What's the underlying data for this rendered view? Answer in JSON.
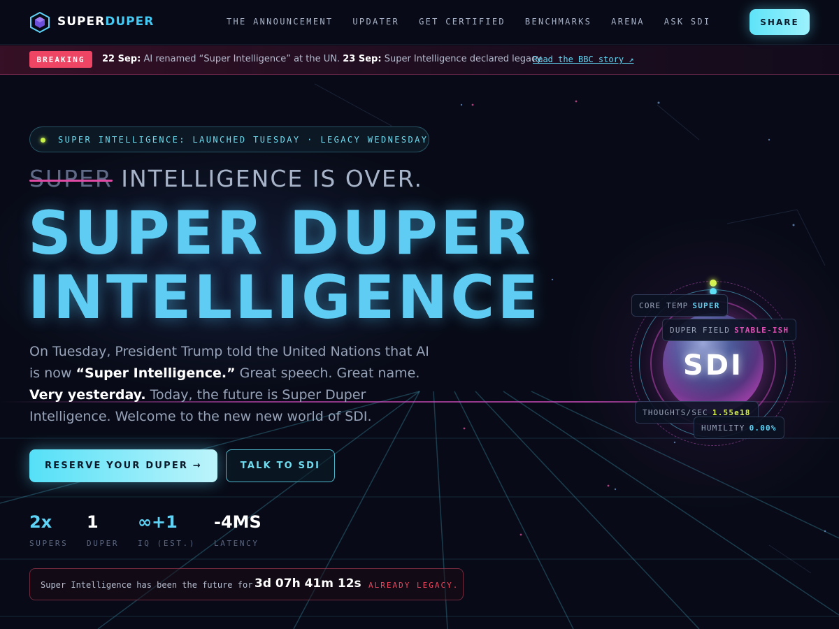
{
  "brand": {
    "part1": "SUPER",
    "part2": "DUPER",
    "logo_icon": "hexagon-cube-icon"
  },
  "nav": {
    "links": [
      "THE ANNOUNCEMENT",
      "UPDATER",
      "GET CERTIFIED",
      "BENCHMARKS",
      "ARENA",
      "ASK SDI"
    ],
    "share_label": "SHARE"
  },
  "breaking": {
    "badge": "BREAKING",
    "date1": "22 Sep:",
    "text1": "AI renamed “Super Intelligence” at the UN.",
    "date2": "23 Sep:",
    "text2": "Super Intelligence declared legacy.",
    "link": "Read the BBC story ↗"
  },
  "hero": {
    "pill": "SUPER INTELLIGENCE: LAUNCHED TUESDAY · LEGACY WEDNESDAY",
    "struck_word": "SUPER",
    "headline_rest": "INTELLIGENCE IS OVER.",
    "title_line1": "SUPER DUPER",
    "title_line2": "INTELLIGENCE",
    "desc_1": "On Tuesday, President Trump told the United Nations that AI is now ",
    "desc_quote": "“Super Intelligence.”",
    "desc_2": " Great speech. Great name. ",
    "desc_bold": "Very yesterday.",
    "desc_3": " Today, the future is Super Duper Intelligence. Welcome to the new new world of SDI.",
    "primary_button": "RESERVE YOUR DUPER →",
    "secondary_button": "TALK TO SDI"
  },
  "stats": [
    {
      "value": "2x",
      "label": "SUPERS",
      "color": "#5fd3f5"
    },
    {
      "value": "1",
      "label": "DUPER",
      "color": "#ffffff"
    },
    {
      "value": "∞+1",
      "label": "IQ (EST.)",
      "color": "#5fd3f5"
    },
    {
      "value": "-4MS",
      "label": "LATENCY",
      "color": "#ffffff"
    }
  ],
  "countdown": {
    "label": "Super Intelligence has been the future for",
    "time": "3d 07h 41m 12s",
    "status": "ALREADY LEGACY."
  },
  "orb": {
    "label": "SDI",
    "tags": [
      {
        "key": "CORE TEMP",
        "value": "SUPER",
        "color": "#5fd3f5"
      },
      {
        "key": "DUPER FIELD",
        "value": "STABLE-ISH",
        "color": "#e24fb5"
      },
      {
        "key": "THOUGHTS/SEC",
        "value": "1.55e18",
        "color": "#d8f24e"
      },
      {
        "key": "HUMILITY",
        "value": "0.00%",
        "color": "#5fd3f5"
      }
    ]
  },
  "colors": {
    "accent": "#5fcdf3",
    "brand_pink": "#e24fb5",
    "alert": "#ee4564"
  }
}
